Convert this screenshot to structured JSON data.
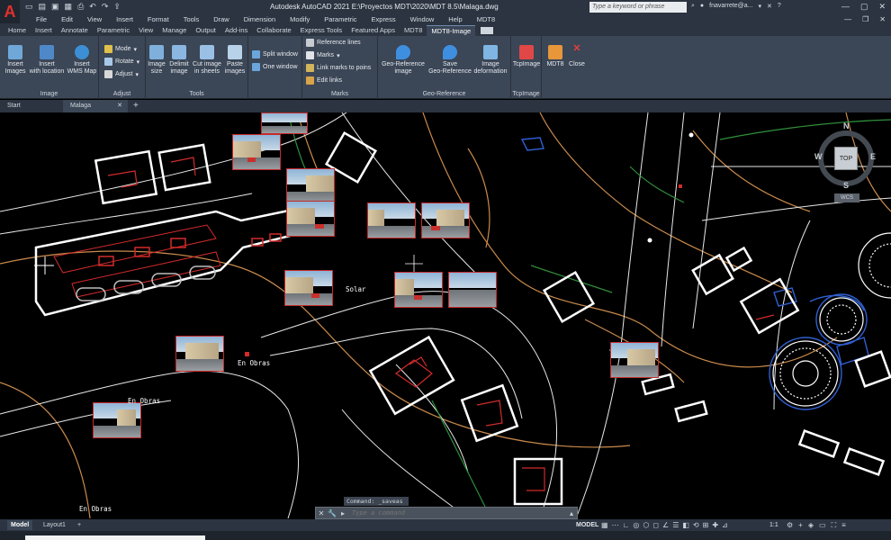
{
  "titlebar": {
    "app_logo": "A",
    "title": "Autodesk AutoCAD 2021    E:\\Proyectos MDT\\2020\\MDT 8.5\\Malaga.dwg",
    "search_placeholder": "Type a keyword or phrase",
    "user": "fnavarrete@a..."
  },
  "menu": [
    "File",
    "Edit",
    "View",
    "Insert",
    "Format",
    "Tools",
    "Draw",
    "Dimension",
    "Modify",
    "Parametric",
    "Express",
    "Window",
    "Help",
    "MDT8"
  ],
  "ribbon_tabs": [
    "Home",
    "Insert",
    "Annotate",
    "Parametric",
    "View",
    "Manage",
    "Output",
    "Add-ins",
    "Collaborate",
    "Express Tools",
    "Featured Apps",
    "MDT8",
    "MDT8-Image"
  ],
  "ribbon": {
    "image": {
      "label": "Image",
      "insert_images": "Insert\nImages",
      "insert_with_location": "Insert\nwith location",
      "insert_wms_map": "Insert\nWMS Map"
    },
    "adjust": {
      "label": "Adjust",
      "mode": "Mode",
      "rotate": "Rotate",
      "adjust": "Adjust"
    },
    "tools": {
      "label": "Tools",
      "image_size": "Image\nsize",
      "delimit_image": "Delimit\nimage",
      "cut_image": "Cut image\nin sheets",
      "paste_images": "Paste\nimages"
    },
    "windows": {
      "split_window": "Split window",
      "one_window": "One window"
    },
    "marks": {
      "label": "Marks",
      "reference_lines": "Reference lines",
      "marks": "Marks",
      "link_marks": "Link marks to poins",
      "edit_links": "Edit links"
    },
    "georef": {
      "label": "Geo-Reference",
      "geo_reference_image": "Geo-Reference\nimage",
      "save_geo_reference": "Save\nGeo-Reference",
      "image_deformation": "Image\ndeformation"
    },
    "tcpimage": {
      "label": "TcpImage",
      "tcpimage": "TcpImage"
    },
    "mdt8": {
      "mdt8": "MDT8",
      "close": "Close"
    }
  },
  "doc_tabs": [
    {
      "label": "Start"
    },
    {
      "label": "Malaga"
    }
  ],
  "canvas": {
    "texts": [
      "Solar",
      "En Obras",
      "En Obras",
      "En Obras"
    ]
  },
  "viewcube": {
    "top": "TOP",
    "n": "N",
    "s": "S",
    "e": "E",
    "w": "W",
    "wcs": "WCS"
  },
  "command": {
    "history": "Command: _saveas",
    "placeholder": "Type a command"
  },
  "status": {
    "layout_tabs": [
      "Model",
      "Layout1"
    ],
    "mode": "MODEL",
    "scale": "1:1"
  },
  "colors": {
    "ui_dark": "#2b3440",
    "ribbon_bg": "#3b4656",
    "canvas_bg": "#000000",
    "building_outline": "#ffffff",
    "building_detail": "#d22b2b",
    "contour": "#c98a4c",
    "green_line": "#2f8f3a",
    "blue_line": "#2f5fd1"
  }
}
